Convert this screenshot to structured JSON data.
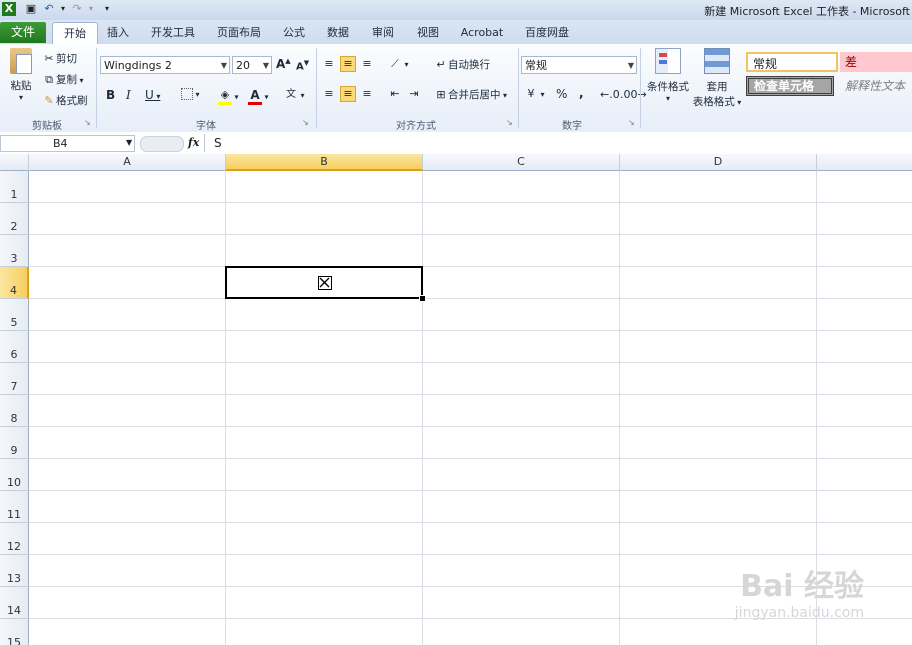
{
  "window": {
    "title": "新建 Microsoft Excel 工作表 - Microsoft"
  },
  "tabs": [
    "文件",
    "开始",
    "插入",
    "开发工具",
    "页面布局",
    "公式",
    "数据",
    "审阅",
    "视图",
    "Acrobat",
    "百度网盘"
  ],
  "clipboard": {
    "paste": "粘贴",
    "cut": "剪切",
    "copy": "复制",
    "format_painter": "格式刷",
    "label": "剪贴板"
  },
  "font": {
    "name": "Wingdings 2",
    "size": "20",
    "bold": "B",
    "italic": "I",
    "underline": "U",
    "grow": "A",
    "shrink": "A",
    "label": "字体"
  },
  "alignment": {
    "wrap": "自动换行",
    "merge": "合并后居中",
    "label": "对齐方式"
  },
  "number": {
    "format": "常规",
    "percent": "%",
    "comma": ",",
    "label": "数字"
  },
  "styles": {
    "conditional": "条件格式",
    "table1": "套用",
    "table2": "表格格式",
    "normal": "常规",
    "bad": "差",
    "check": "检查单元格",
    "explanatory": "解释性文本"
  },
  "formula_bar": {
    "name_box": "B4",
    "fx": "fx",
    "content": "S"
  },
  "columns": [
    "A",
    "B",
    "C",
    "D"
  ],
  "rows": [
    "1",
    "2",
    "3",
    "4",
    "5",
    "6",
    "7",
    "8",
    "9",
    "10",
    "11",
    "12",
    "13",
    "14",
    "15"
  ],
  "selected": {
    "column": "B",
    "row": "4",
    "cell_symbol": "☒"
  },
  "watermark": {
    "brand": "Bai 经验",
    "url": "jingyan.baidu.com"
  },
  "colors": {
    "file_tab": "#2e8b2e",
    "selection_header": "#f6cf5f",
    "bad_style_bg": "#ffc7ce",
    "check_style_bg": "#a5a5a5"
  }
}
